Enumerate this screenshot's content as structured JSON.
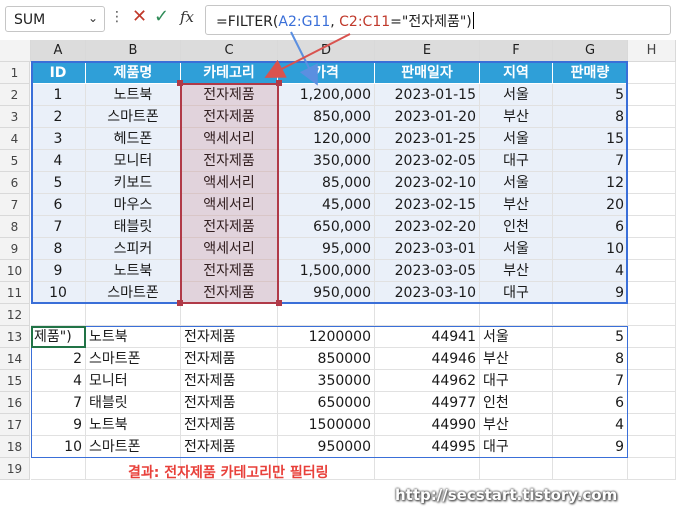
{
  "namebox": {
    "value": "SUM"
  },
  "formula_bar": {
    "more_icon": "⋮",
    "cancel_icon": "✕",
    "enter_icon": "✓",
    "fx_label": "fx",
    "parts": {
      "prefix": "=FILTER(",
      "ref1": "A2:G11",
      "sep": ", ",
      "ref2": "C2:C11",
      "suffix": "=\"전자제품\")"
    }
  },
  "columns": [
    "A",
    "B",
    "C",
    "D",
    "E",
    "F",
    "G",
    "H"
  ],
  "rows": [
    "1",
    "2",
    "3",
    "4",
    "5",
    "6",
    "7",
    "8",
    "9",
    "10",
    "11",
    "12",
    "13",
    "14",
    "15",
    "16",
    "17",
    "18",
    "19"
  ],
  "headers": [
    "ID",
    "제품명",
    "카테고리",
    "가격",
    "판매일자",
    "지역",
    "판매량"
  ],
  "table": [
    [
      "1",
      "노트북",
      "전자제품",
      "1,200,000",
      "2023-01-15",
      "서울",
      "5"
    ],
    [
      "2",
      "스마트폰",
      "전자제품",
      "850,000",
      "2023-01-20",
      "부산",
      "8"
    ],
    [
      "3",
      "헤드폰",
      "액세서리",
      "120,000",
      "2023-01-25",
      "서울",
      "15"
    ],
    [
      "4",
      "모니터",
      "전자제품",
      "350,000",
      "2023-02-05",
      "대구",
      "7"
    ],
    [
      "5",
      "키보드",
      "액세서리",
      "85,000",
      "2023-02-10",
      "서울",
      "12"
    ],
    [
      "6",
      "마우스",
      "액세서리",
      "45,000",
      "2023-02-15",
      "부산",
      "20"
    ],
    [
      "7",
      "태블릿",
      "전자제품",
      "650,000",
      "2023-02-20",
      "인천",
      "6"
    ],
    [
      "8",
      "스피커",
      "액세서리",
      "95,000",
      "2023-03-01",
      "서울",
      "10"
    ],
    [
      "9",
      "노트북",
      "전자제품",
      "1,500,000",
      "2023-03-05",
      "부산",
      "4"
    ],
    [
      "10",
      "스마트폰",
      "전자제품",
      "950,000",
      "2023-03-10",
      "대구",
      "9"
    ]
  ],
  "result": [
    [
      "제품\")",
      "노트북",
      "전자제품",
      "1200000",
      "44941",
      "서울",
      "5"
    ],
    [
      "2",
      "스마트폰",
      "전자제품",
      "850000",
      "44946",
      "부산",
      "8"
    ],
    [
      "4",
      "모니터",
      "전자제품",
      "350000",
      "44962",
      "대구",
      "7"
    ],
    [
      "7",
      "태블릿",
      "전자제품",
      "650000",
      "44977",
      "인천",
      "6"
    ],
    [
      "9",
      "노트북",
      "전자제품",
      "1500000",
      "44990",
      "부산",
      "4"
    ],
    [
      "10",
      "스마트폰",
      "전자제품",
      "950000",
      "44995",
      "대구",
      "9"
    ]
  ],
  "caption": "결과: 전자제품 카테고리만 필터링",
  "watermark": "http://secstart.tistory.com",
  "colors": {
    "header_blue": "#2f9fd8",
    "ref_blue": "#3a6fd8",
    "ref_red": "#c0392b",
    "caption_red": "#e8403a"
  }
}
